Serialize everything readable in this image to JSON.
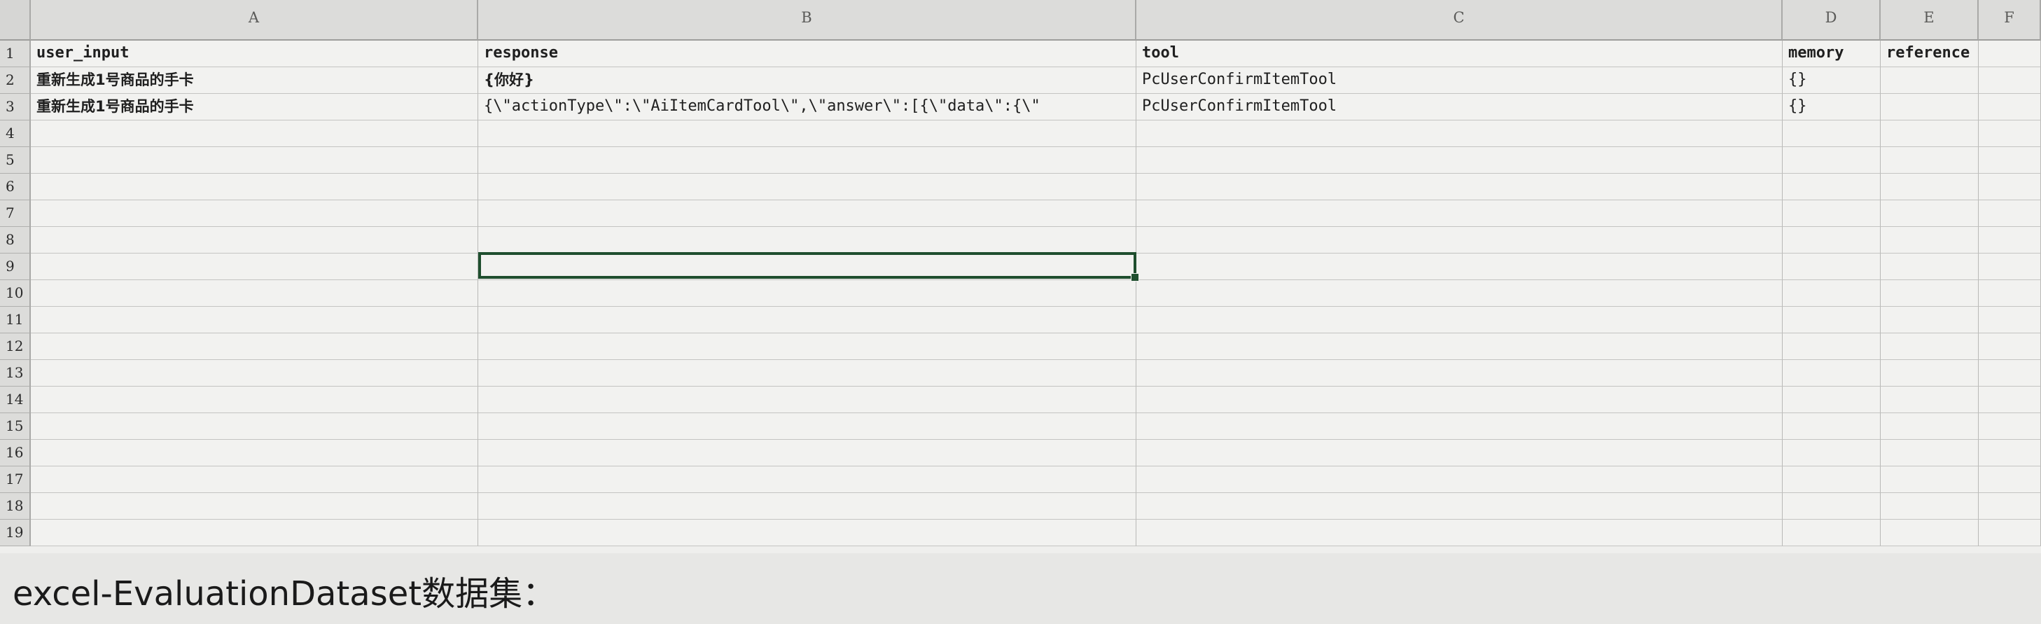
{
  "columns": [
    {
      "letter": "A"
    },
    {
      "letter": "B"
    },
    {
      "letter": "C"
    },
    {
      "letter": "D"
    },
    {
      "letter": "E"
    },
    {
      "letter": "F"
    }
  ],
  "rows": [
    "1",
    "2",
    "3",
    "4",
    "5",
    "6",
    "7",
    "8",
    "9",
    "10",
    "11",
    "12",
    "13",
    "14",
    "15",
    "16",
    "17",
    "18",
    "19"
  ],
  "cells": {
    "A1": "user_input",
    "B1": "response",
    "C1": "tool",
    "D1": "memory",
    "E1": "reference",
    "A2": "重新生成1号商品的手卡",
    "B2": "{你好}",
    "C2": "PcUserConfirmItemTool",
    "D2": "{}",
    "A3": "重新生成1号商品的手卡",
    "B3": "{\\\"actionType\\\":\\\"AiItemCardTool\\\",\\\"answer\\\":[{\\\"data\\\":{\\\"",
    "C3": "PcUserConfirmItemTool",
    "D3": "{}"
  },
  "selection": {
    "cell": "B9"
  },
  "caption": "excel-EvaluationDataset数据集："
}
